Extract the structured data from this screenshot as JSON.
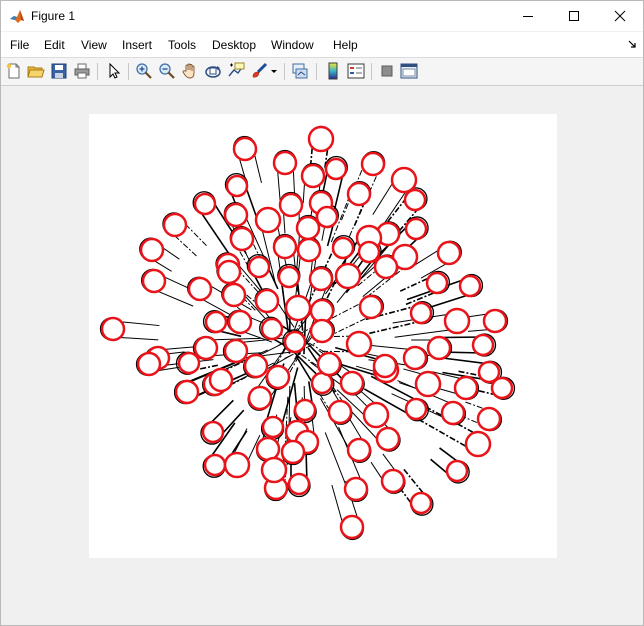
{
  "window": {
    "title": "Figure 1"
  },
  "menu": [
    "File",
    "Edit",
    "View",
    "Insert",
    "Tools",
    "Desktop",
    "Window",
    "Help"
  ],
  "toolbar_buttons": [
    "new-figure-icon",
    "open-file-icon",
    "save-icon",
    "print-icon",
    "edit-plot-icon",
    "zoom-in-icon",
    "zoom-out-icon",
    "pan-icon",
    "rotate-3d-icon",
    "data-cursor-icon",
    "brush-icon",
    "brush-dropdown-icon",
    "link-plot-icon",
    "colorbar-icon",
    "legend-icon",
    "hide-plot-tools-icon",
    "show-plot-tools-icon"
  ],
  "figure": {
    "circle_color": "#e8141a",
    "detected_circle_count": 104
  }
}
